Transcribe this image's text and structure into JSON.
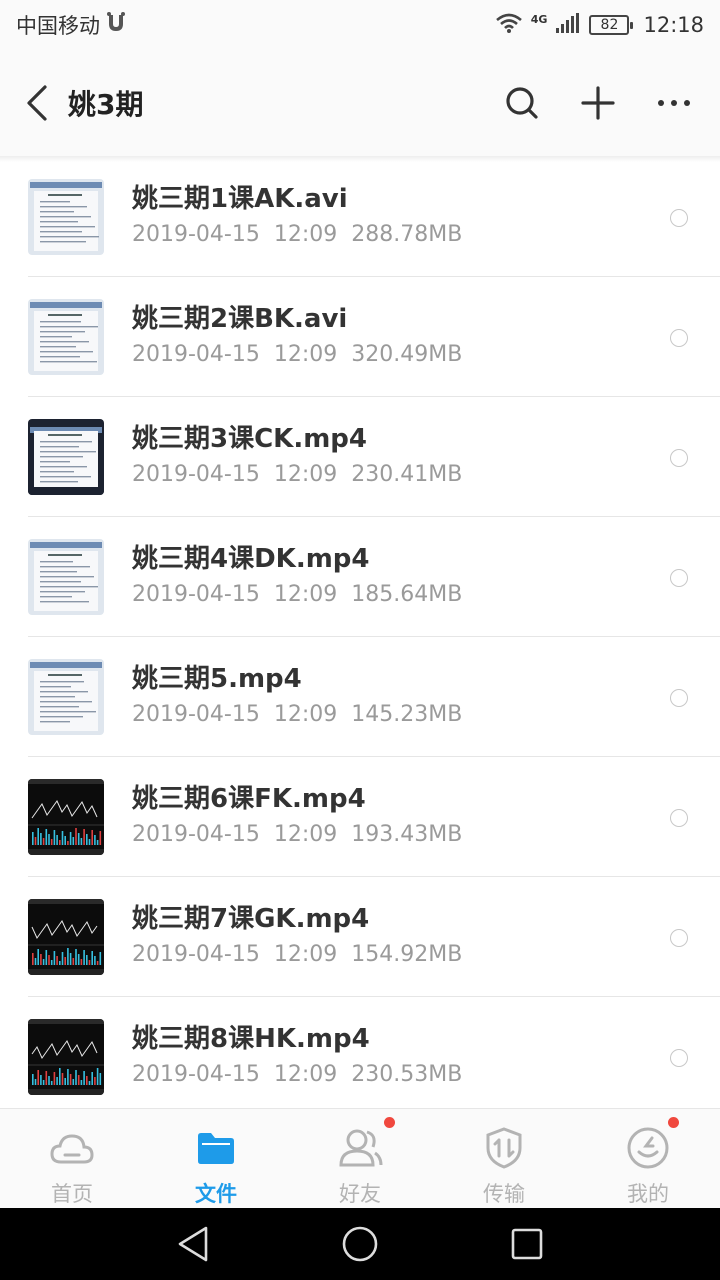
{
  "status_bar": {
    "carrier": "中国移动",
    "network": "4G",
    "battery": "82",
    "time": "12:18"
  },
  "header": {
    "title": "姚3期",
    "icons": {
      "back": "back-arrow-icon",
      "search": "search-icon",
      "add": "plus-icon",
      "more": "more-dots-icon"
    }
  },
  "files": [
    {
      "name": "姚三期1课AK.avi",
      "date": "2019-04-15",
      "time": "12:09",
      "size": "288.78MB",
      "thumb": "document"
    },
    {
      "name": "姚三期2课BK.avi",
      "date": "2019-04-15",
      "time": "12:09",
      "size": "320.49MB",
      "thumb": "document"
    },
    {
      "name": "姚三期3课CK.mp4",
      "date": "2019-04-15",
      "time": "12:09",
      "size": "230.41MB",
      "thumb": "document-dark"
    },
    {
      "name": "姚三期4课DK.mp4",
      "date": "2019-04-15",
      "time": "12:09",
      "size": "185.64MB",
      "thumb": "document"
    },
    {
      "name": "姚三期5.mp4",
      "date": "2019-04-15",
      "time": "12:09",
      "size": "145.23MB",
      "thumb": "document"
    },
    {
      "name": "姚三期6课FK.mp4",
      "date": "2019-04-15",
      "time": "12:09",
      "size": "193.43MB",
      "thumb": "stock-chart"
    },
    {
      "name": "姚三期7课GK.mp4",
      "date": "2019-04-15",
      "time": "12:09",
      "size": "154.92MB",
      "thumb": "stock-chart"
    },
    {
      "name": "姚三期8课HK.mp4",
      "date": "2019-04-15",
      "time": "12:09",
      "size": "230.53MB",
      "thumb": "stock-chart"
    }
  ],
  "bottom_nav": [
    {
      "label": "首页",
      "icon": "cloud-icon",
      "active": false,
      "badge": false
    },
    {
      "label": "文件",
      "icon": "folder-icon",
      "active": true,
      "badge": false
    },
    {
      "label": "好友",
      "icon": "friends-icon",
      "active": false,
      "badge": true
    },
    {
      "label": "传输",
      "icon": "transfer-icon",
      "active": false,
      "badge": false
    },
    {
      "label": "我的",
      "icon": "profile-icon",
      "active": false,
      "badge": true
    }
  ],
  "colors": {
    "accent": "#1e9be9",
    "inactive": "#b3b3b3",
    "badge": "#f0483e"
  }
}
